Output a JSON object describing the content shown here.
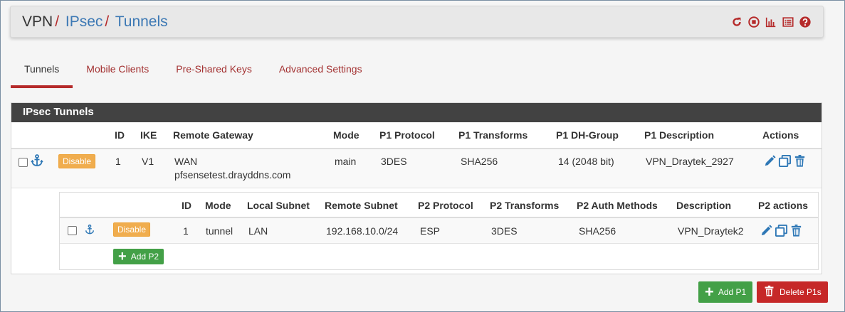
{
  "breadcrumb": {
    "root": "VPN",
    "sep": "/",
    "level2": "IPsec",
    "level3": "Tunnels"
  },
  "tabs": [
    {
      "label": "Tunnels",
      "active": true
    },
    {
      "label": "Mobile Clients"
    },
    {
      "label": "Pre-Shared Keys"
    },
    {
      "label": "Advanced Settings"
    }
  ],
  "panel": {
    "title": "IPsec Tunnels"
  },
  "p1": {
    "columns": {
      "id": "ID",
      "ike": "IKE",
      "gateway": "Remote Gateway",
      "mode": "Mode",
      "protocol": "P1 Protocol",
      "transforms": "P1 Transforms",
      "dh": "P1 DH-Group",
      "desc": "P1 Description",
      "actions": "Actions"
    },
    "row": {
      "disable_label": "Disable",
      "id": "1",
      "ike": "V1",
      "gateway_iface": "WAN",
      "gateway_host": "pfsensetest.drayddns.com",
      "mode": "main",
      "protocol": "3DES",
      "transforms": "SHA256",
      "dh": "14 (2048 bit)",
      "desc": "VPN_Draytek_2927"
    }
  },
  "p2": {
    "columns": {
      "id": "ID",
      "mode": "Mode",
      "local": "Local Subnet",
      "remote": "Remote Subnet",
      "protocol": "P2 Protocol",
      "transforms": "P2 Transforms",
      "auth": "P2 Auth Methods",
      "desc": "Description",
      "actions": "P2 actions"
    },
    "row": {
      "disable_label": "Disable",
      "id": "1",
      "mode": "tunnel",
      "local": "LAN",
      "remote": "192.168.10.0/24",
      "protocol": "ESP",
      "transforms": "3DES",
      "auth": "SHA256",
      "desc": "VPN_Draytek2"
    },
    "add_label": "Add P2"
  },
  "footer": {
    "add_p1": "Add P1",
    "delete_p1s": "Delete P1s"
  },
  "colors": {
    "accent_red": "#b52a2a",
    "link_blue": "#3c78b4",
    "warning": "#f0ad4e",
    "success": "#43a047",
    "danger": "#c62828",
    "panel_head": "#424242"
  }
}
